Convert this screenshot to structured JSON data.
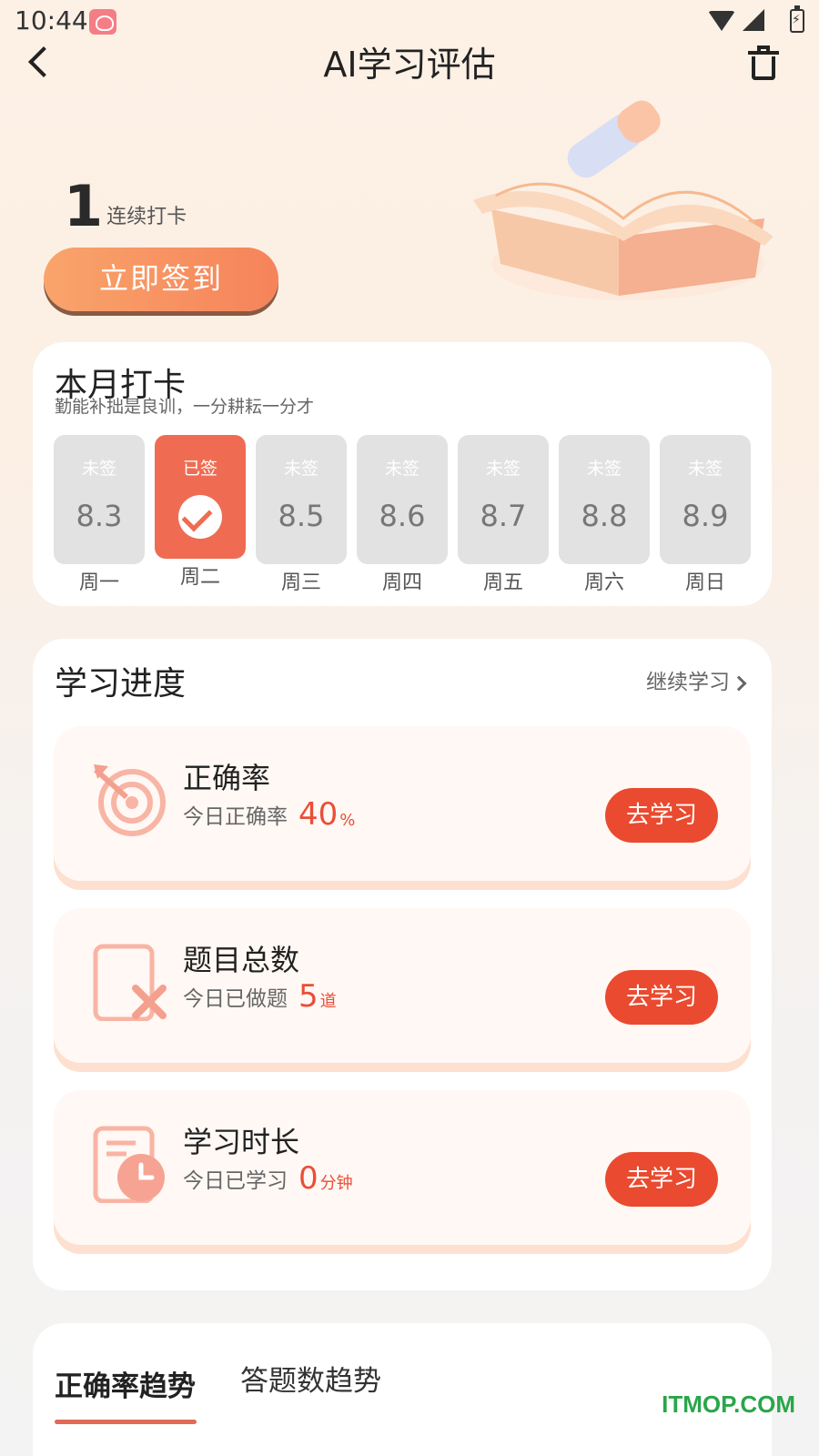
{
  "status_bar": {
    "time": "10:44"
  },
  "nav": {
    "title": "AI学习评估"
  },
  "hero": {
    "streak_count": "1",
    "streak_label": "连续打卡",
    "checkin_button": "立即签到"
  },
  "month": {
    "title": "本月打卡",
    "subtitle": "勤能补拙是良训，一分耕耘一分才",
    "days": [
      {
        "status": "未签",
        "date": "8.3",
        "weekday": "周一",
        "signed": false
      },
      {
        "status": "已签",
        "date": "",
        "weekday": "周二",
        "signed": true
      },
      {
        "status": "未签",
        "date": "8.5",
        "weekday": "周三",
        "signed": false
      },
      {
        "status": "未签",
        "date": "8.6",
        "weekday": "周四",
        "signed": false
      },
      {
        "status": "未签",
        "date": "8.7",
        "weekday": "周五",
        "signed": false
      },
      {
        "status": "未签",
        "date": "8.8",
        "weekday": "周六",
        "signed": false
      },
      {
        "status": "未签",
        "date": "8.9",
        "weekday": "周日",
        "signed": false
      }
    ]
  },
  "progress": {
    "title": "学习进度",
    "continue_link": "继续学习",
    "stats": [
      {
        "title": "正确率",
        "subtitle": "今日正确率",
        "value": "40",
        "unit": "%",
        "button": "去学习",
        "icon": "target-icon"
      },
      {
        "title": "题目总数",
        "subtitle": "今日已做题",
        "value": "5",
        "unit": "道",
        "button": "去学习",
        "icon": "wrong-question-icon"
      },
      {
        "title": "学习时长",
        "subtitle": "今日已学习",
        "value": "0",
        "unit": "分钟",
        "button": "去学习",
        "icon": "clock-doc-icon"
      }
    ]
  },
  "trend": {
    "tabs": [
      "正确率趋势",
      "答题数趋势"
    ],
    "active_tab": 0
  },
  "watermark": "ITMOP.COM",
  "colors": {
    "accent": "#ea4a2f",
    "signed": "#ef6c53",
    "checkin_start": "#f9a46b",
    "checkin_end": "#f6835a"
  }
}
